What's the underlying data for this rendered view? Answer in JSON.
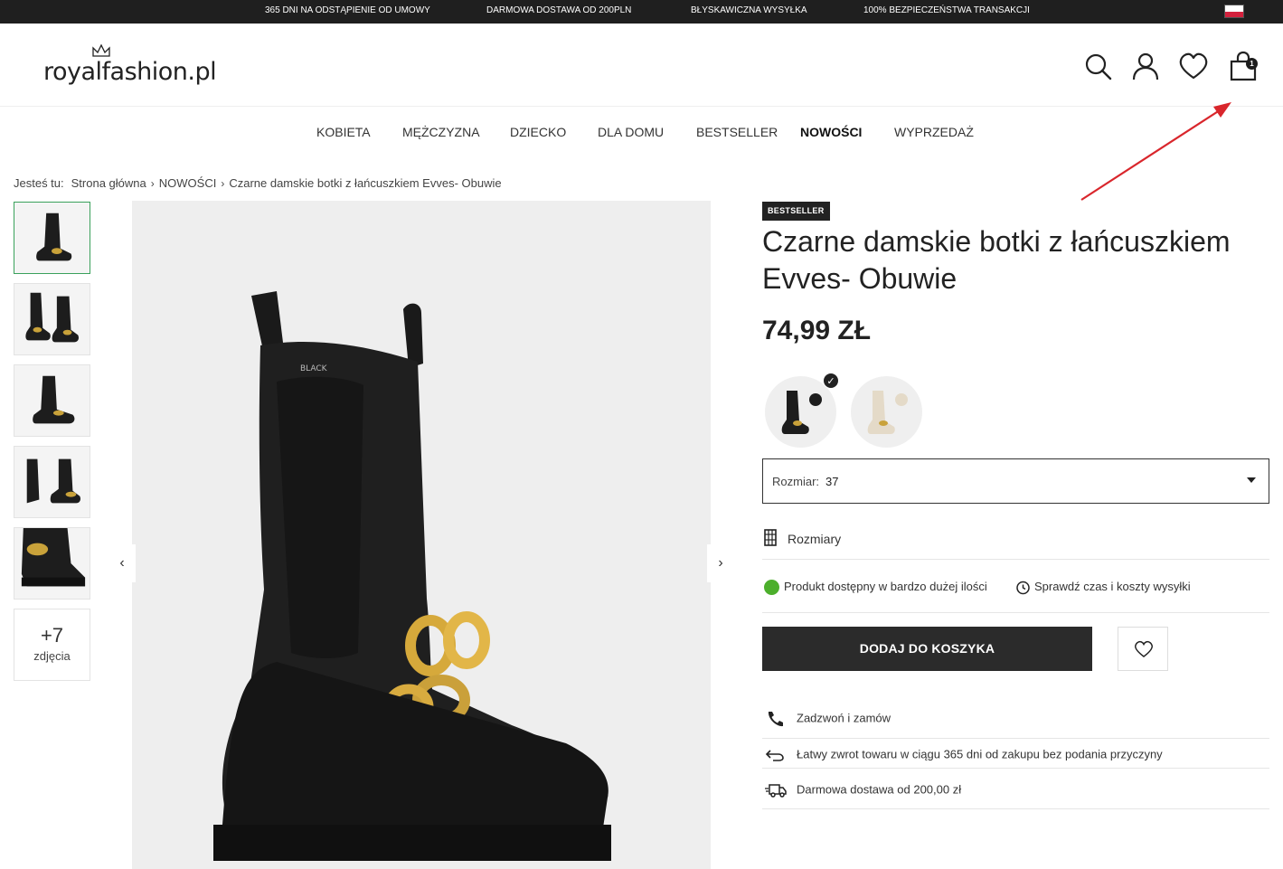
{
  "topbar": {
    "messages": [
      "365 DNI NA ODSTĄPIENIE OD UMOWY",
      "DARMOWA DOSTAWA OD 200PLN",
      "BŁYSKAWICZNA WYSYŁKA",
      "100% BEZPIECZEŃSTWA TRANSAKCJI"
    ]
  },
  "header": {
    "logo": "royalfashion.pl",
    "cart_count": "1"
  },
  "nav": {
    "items": [
      "KOBIETA",
      "MĘŻCZYZNA",
      "DZIECKO",
      "DLA DOMU",
      "BESTSELLER",
      "NOWOŚCI",
      "WYPRZEDAŻ"
    ]
  },
  "breadcrumb": {
    "label": "Jesteś tu:",
    "items": [
      "Strona główna",
      "NOWOŚCI",
      "Czarne damskie botki z łańcuszkiem Evves- Obuwie"
    ]
  },
  "gallery": {
    "more_count": "+7",
    "more_label": "zdjęcia"
  },
  "product": {
    "badge": "BESTSELLER",
    "title": "Czarne damskie botki z łańcuszkiem Evves- Obuwie",
    "price": "74,99 ZŁ",
    "size_label": "Rozmiar:",
    "size_value": "37",
    "sizes_link": "Rozmiary",
    "availability": "Produkt dostępny w bardzo dużej ilości",
    "shipping_check": "Sprawdź czas i koszty wysyłki",
    "add_to_cart": "DODAJ DO KOSZYKA",
    "info": [
      "Zadzwoń i zamów",
      "Łatwy zwrot towaru w ciągu 365 dni od zakupu bez podania przyczyny",
      "Darmowa dostawa od 200,00 zł"
    ]
  },
  "colors": {
    "topbar_bg": "#1f1f1f",
    "button_bg": "#2b2b2b",
    "available_dot": "#4caf2c",
    "arrow": "#d9262c",
    "thumb_active_border": "#3aa15b"
  }
}
